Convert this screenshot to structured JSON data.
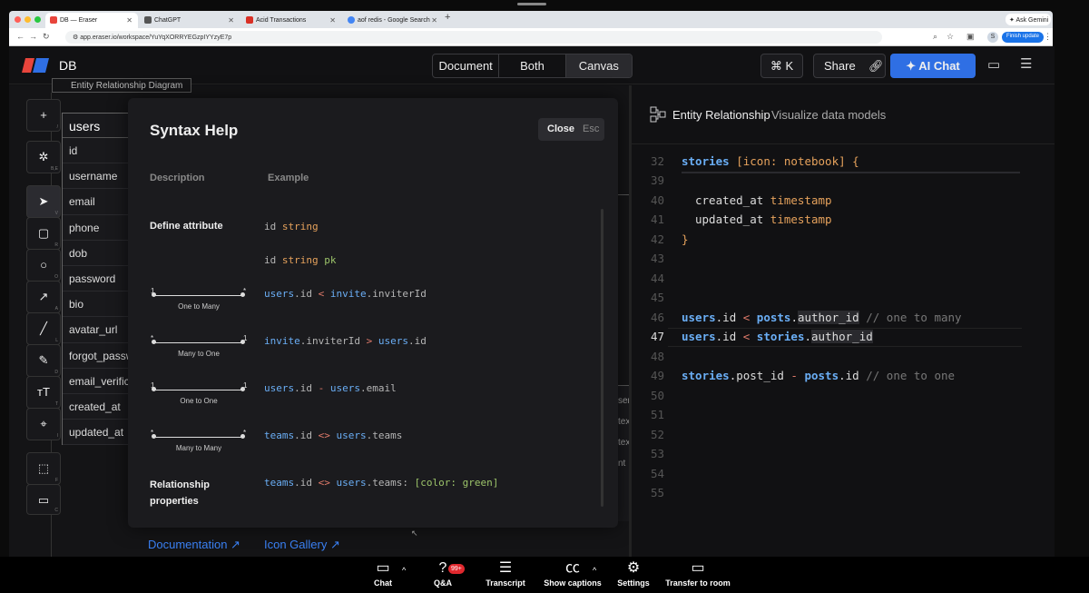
{
  "browser": {
    "tabs": [
      {
        "label": "DB — Eraser",
        "color": "#e8453c"
      },
      {
        "label": "ChatGPT",
        "color": "#555555"
      },
      {
        "label": "Acid Transactions",
        "color": "#d93025"
      },
      {
        "label": "aof redis - Google Search",
        "color": "#4285f4"
      }
    ],
    "new_tab": "+",
    "ask_gemini": "Ask Gemini",
    "url": "app.eraser.io/workspace/YuYqXORRYEGzpIYYzyE7p",
    "finish_update": "Finish update",
    "profile": "S"
  },
  "app": {
    "doc_title": "DB",
    "view_tabs": [
      "Document",
      "Both",
      "Canvas"
    ],
    "cmd_k": "⌘ K",
    "share": "Share",
    "ai_chat": "AI Chat",
    "accent": "#2f6fe4"
  },
  "canvas": {
    "erd_title": "Entity Relationship Diagram",
    "tools": [
      {
        "icon": "+",
        "key": "/"
      },
      {
        "icon": "✲",
        "key": "B,E"
      },
      {
        "icon": "➤",
        "key": "V"
      },
      {
        "icon": "▢",
        "key": "R"
      },
      {
        "icon": "○",
        "key": "O"
      },
      {
        "icon": "↗",
        "key": "A"
      },
      {
        "icon": "╱",
        "key": "L"
      },
      {
        "icon": "✎",
        "key": "D"
      },
      {
        "icon": "ᴛT",
        "key": "T"
      },
      {
        "icon": "⌖",
        "key": "I"
      },
      {
        "icon": "⬚",
        "key": "F"
      },
      {
        "icon": "▭",
        "key": "C"
      }
    ],
    "users_table": {
      "name": "users",
      "fields": [
        "id",
        "username",
        "email",
        "phone",
        "dob",
        "password",
        "bio",
        "avatar_url",
        "forgot_passw",
        "email_verifica",
        "created_at",
        "updated_at"
      ]
    },
    "partial_right": [
      "sen",
      "tex",
      "tex",
      "nt"
    ]
  },
  "syntax_help": {
    "title": "Syntax Help",
    "close": "Close",
    "esc": "Esc",
    "col_description": "Description",
    "col_example": "Example",
    "define_attribute": "Define attribute",
    "relationship_properties": "Relationship properties",
    "relations": [
      {
        "label": "One to Many",
        "left": "1",
        "right": "*"
      },
      {
        "label": "Many to One",
        "left": "*",
        "right": "1"
      },
      {
        "label": "One to One",
        "left": "1",
        "right": "1"
      },
      {
        "label": "Many to Many",
        "left": "*",
        "right": "*"
      }
    ],
    "documentation": "Documentation ↗",
    "icon_gallery": "Icon Gallery ↗"
  },
  "editor": {
    "header_title": "Entity Relationship",
    "header_sub": "Visualize data models",
    "line_numbers": [
      "32",
      "39",
      "40",
      "41",
      "42",
      "43",
      "44",
      "45",
      "46",
      "47",
      "48",
      "49",
      "50",
      "51",
      "52",
      "53",
      "54",
      "55"
    ],
    "active_line": "47"
  },
  "meeting": {
    "buttons": [
      "Chat",
      "Q&A",
      "Transcript",
      "Show captions",
      "Settings",
      "Transfer to room"
    ],
    "qa_badge": "99+"
  }
}
